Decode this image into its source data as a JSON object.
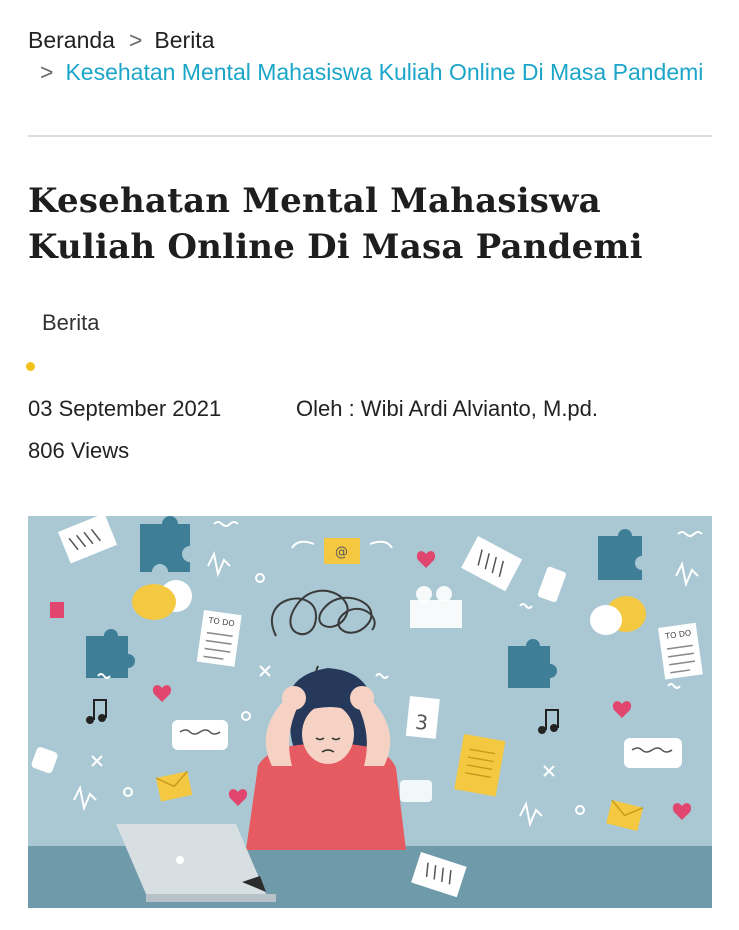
{
  "breadcrumb": {
    "home": "Beranda",
    "separator": ">",
    "category": "Berita",
    "current": "Kesehatan Mental Mahasiswa Kuliah Online Di Masa Pandemi"
  },
  "article": {
    "title": "Kesehatan Mental Mahasiswa Kuliah Online Di Masa Pandemi",
    "category": "Berita",
    "date": "03 September 2021",
    "author": "Oleh : Wibi Ardi Alvianto, M.pd.",
    "views": "806 Views"
  },
  "hero_image": {
    "todo_label": "TO DO",
    "at_symbol": "@",
    "calendar_day": "3"
  },
  "colors": {
    "link": "#1aa5c9",
    "accent_dot": "#f2c21b",
    "illustration_bg": "#a9c8d3",
    "desk": "#6f9aaa"
  }
}
